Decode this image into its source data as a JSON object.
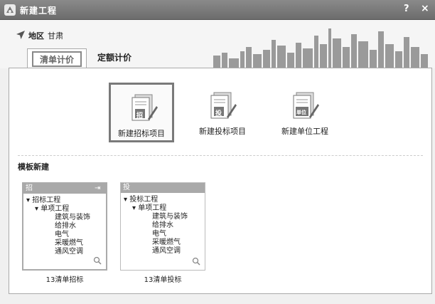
{
  "window": {
    "title": "新建工程",
    "help_label": "?",
    "close_label": "×"
  },
  "region": {
    "label": "地区",
    "value": "甘肃"
  },
  "tabs": [
    {
      "label": "清单计价",
      "active": true
    },
    {
      "label": "定额计价",
      "active": false
    }
  ],
  "projects": [
    {
      "label": "新建招标项目",
      "badge": "招",
      "selected": true
    },
    {
      "label": "新建投标项目",
      "badge": "投",
      "selected": false
    },
    {
      "label": "新建单位工程",
      "badge": "单位",
      "selected": false
    }
  ],
  "template_heading": "模板新建",
  "templates": [
    {
      "badge": "招",
      "caption": "13清单招标",
      "tree": {
        "root": "招标工程",
        "child": "单项工程",
        "leaves": [
          "建筑与装饰",
          "给排水",
          "电气",
          "采暖燃气",
          "通风空调"
        ]
      }
    },
    {
      "badge": "投",
      "caption": "13清单投标",
      "tree": {
        "root": "投标工程",
        "child": "单项工程",
        "leaves": [
          "建筑与装饰",
          "给排水",
          "电气",
          "采暖燃气",
          "通风空调"
        ]
      }
    }
  ]
}
